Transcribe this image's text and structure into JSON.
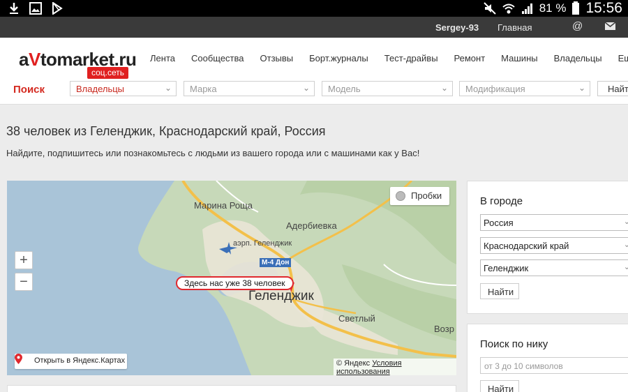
{
  "statusbar": {
    "battery": "81 %",
    "time": "15:56",
    "icons": [
      "download-icon",
      "image-icon",
      "play-store-icon",
      "mute-icon",
      "wifi-icon",
      "signal-icon",
      "battery-icon"
    ]
  },
  "userbar": {
    "username": "Sergey-93",
    "home": "Главная",
    "at": "@"
  },
  "header": {
    "logo_prefix": "a",
    "logo_v": "V",
    "logo_suffix": "tomarket.ru",
    "logo_badge": "соц.сеть",
    "nav": [
      "Лента",
      "Сообщества",
      "Отзывы",
      "Борт.журналы",
      "Тест-драйвы",
      "Ремонт",
      "Машины",
      "Владельцы",
      "Ещё"
    ],
    "search_label": "Поиск",
    "search_type": "Владельцы",
    "brand_placeholder": "Марка",
    "model_placeholder": "Модель",
    "modification_placeholder": "Модификация",
    "find_button": "Найти"
  },
  "page": {
    "title": "38 человек из Геленджик, Краснодарский край, Россия",
    "subtitle": "Найдите, подпишитесь или познакомьтесь с людьми из вашего города или с машинами как у Вас!"
  },
  "map": {
    "zoom_in": "+",
    "zoom_out": "−",
    "traffic": "Пробки",
    "open_yandex": "Открыть в Яндекс.Картах",
    "copyright": "© Яндекс",
    "terms": "Условия использования",
    "balloon": "Здесь нас уже 38 человек",
    "labels": {
      "marina_roshcha": "Марина Роща",
      "aderbievka": "Адербиевка",
      "airport": "аэрп. Геленджик",
      "road": "М-4 Дон",
      "city": "Геленджик",
      "svetly": "Светлый",
      "vozr": "Возр"
    },
    "colors": {
      "sea": "#a9c4d8",
      "land": "#e9e4d6",
      "forest": "#c7d9b9",
      "road": "#f3c04a",
      "marker": "#e0282e"
    }
  },
  "sidebar": {
    "city_title": "В городе",
    "country": "Россия",
    "region": "Краснодарский край",
    "city": "Геленджик",
    "city_find": "Найти",
    "nick_title": "Поиск по нику",
    "nick_placeholder": "от 3 до 10 символов",
    "nick_find": "Найти"
  }
}
